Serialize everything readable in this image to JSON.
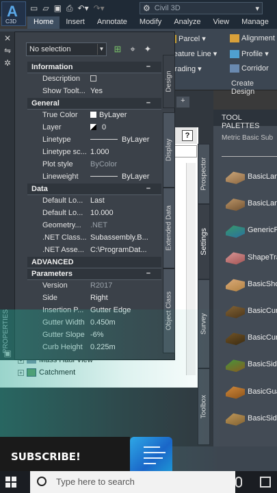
{
  "app": {
    "logo_letter": "A",
    "version": "C3D",
    "workspace": "Civil 3D"
  },
  "ribbon": {
    "tabs": [
      "Home",
      "Insert",
      "Annotate",
      "Modify",
      "Analyze",
      "View",
      "Manage"
    ],
    "active_tab": "Home",
    "buttons": [
      {
        "label": "Parcel",
        "arrow": "▾"
      },
      {
        "label": "Alignment",
        "arrow": ""
      },
      {
        "label": "Feature Line",
        "arrow": "▾"
      },
      {
        "label": "Profile",
        "arrow": "▾"
      },
      {
        "label": "Grading",
        "arrow": "▾"
      },
      {
        "label": "Corridor",
        "arrow": ""
      }
    ],
    "panel_label": "Create Design"
  },
  "properties": {
    "side_label": "PROPERTIES",
    "selection": "No selection",
    "sections": [
      {
        "title": "Information",
        "rows": [
          {
            "name": "Description",
            "value": "",
            "dim": false
          },
          {
            "name": "Show Toolt...",
            "value": "Yes",
            "dim": false
          }
        ]
      },
      {
        "title": "General",
        "rows": [
          {
            "name": "True Color",
            "value": "ByLayer",
            "dim": false
          },
          {
            "name": "Layer",
            "value": "0",
            "dim": false
          },
          {
            "name": "Linetype",
            "value": "ByLayer",
            "dim": false
          },
          {
            "name": "Linetype sc...",
            "value": "1.000",
            "dim": false
          },
          {
            "name": "Plot style",
            "value": "ByColor",
            "dim": true
          },
          {
            "name": "Lineweight",
            "value": "ByLayer",
            "dim": false
          }
        ]
      },
      {
        "title": "Data",
        "rows": [
          {
            "name": "Default Lo...",
            "value": "Last",
            "dim": false
          },
          {
            "name": "Default Lo...",
            "value": "10.000",
            "dim": false
          },
          {
            "name": "Geometry...",
            "value": ".NET",
            "dim": true
          },
          {
            "name": ".NET Class...",
            "value": "Subassembly.B...",
            "dim": false
          },
          {
            "name": ".NET Asse...",
            "value": "C:\\ProgramDat...",
            "dim": false
          }
        ]
      },
      {
        "title": "ADVANCED",
        "rows": []
      },
      {
        "title": "Parameters",
        "rows": [
          {
            "name": "Version",
            "value": "R2017",
            "dim": true
          },
          {
            "name": "Side",
            "value": "Right",
            "dim": false
          },
          {
            "name": "Insertion P...",
            "value": "Gutter Edge",
            "dim": false
          },
          {
            "name": "Gutter Width",
            "value": "0.450m",
            "dim": false
          },
          {
            "name": "Gutter Slope",
            "value": "-6%",
            "dim": false
          },
          {
            "name": "Curb Height",
            "value": "0.225m",
            "dim": false
          }
        ]
      }
    ],
    "tabs": [
      "Design",
      "Display",
      "Extended Data",
      "Object Class"
    ]
  },
  "prospector": {
    "rows": [
      "Mass Haul View",
      "Catchment"
    ],
    "tabs": [
      "Prospector",
      "Settings",
      "Survey",
      "Toolbox"
    ],
    "help": "?"
  },
  "tool_palettes": {
    "title": "TOOL PALETTES",
    "subtitle": "Metric Basic Sub",
    "items": [
      "BasicLan",
      "BasicLan",
      "GenericP",
      "ShapeTra",
      "BasicSho",
      "BasicCur",
      "BasicCur",
      "BasicSide",
      "BasicGua",
      "BasicSide"
    ]
  },
  "overlay": {
    "subscribe": "SUBSCRIBE!"
  },
  "taskbar": {
    "search_placeholder": "Type here to search"
  }
}
